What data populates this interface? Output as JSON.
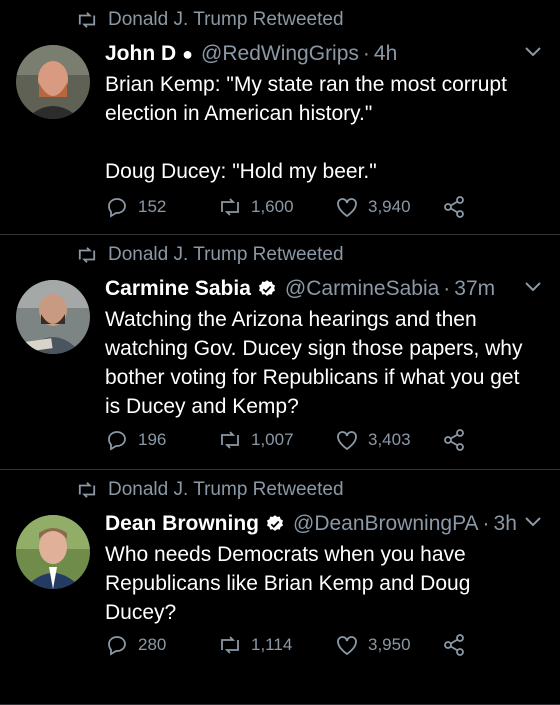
{
  "tweets": [
    {
      "retweeted_by": "Donald J. Trump Retweeted",
      "name": "John D",
      "marker": "●",
      "handle": "@RedWingGrips",
      "time": "4h",
      "text_lines": [
        "Brian Kemp: \"My state ran the most corrupt",
        "election in American history.\"",
        "",
        "Doug Ducey: \"Hold my beer.\""
      ],
      "replies": "152",
      "retweets": "1,600",
      "likes": "3,940"
    },
    {
      "retweeted_by": "Donald J. Trump Retweeted",
      "name": "Carmine Sabia",
      "verified": true,
      "handle": "@CarmineSabia",
      "time": "37m",
      "text_lines": [
        "Watching the Arizona hearings and then",
        "watching Gov. Ducey sign those papers, why",
        "bother voting for Republicans if what you get",
        "is Ducey and Kemp?"
      ],
      "replies": "196",
      "retweets": "1,007",
      "likes": "3,403"
    },
    {
      "retweeted_by": "Donald J. Trump Retweeted",
      "name": "Dean Browning",
      "verified": true,
      "handle": "@DeanBrowningPA",
      "time": "3h",
      "text_lines": [
        "Who needs Democrats when you have",
        "Republicans like Brian Kemp and Doug",
        "Ducey?"
      ],
      "replies": "280",
      "retweets": "1,114",
      "likes": "3,950"
    }
  ],
  "colors": {
    "background": "#000000",
    "text": "#ffffff",
    "muted": "#8b98a5",
    "verified": "#ffffff"
  },
  "icons": [
    "retweet-icon",
    "chevron-down-icon",
    "reply-icon",
    "like-icon",
    "share-icon",
    "verified-icon"
  ]
}
